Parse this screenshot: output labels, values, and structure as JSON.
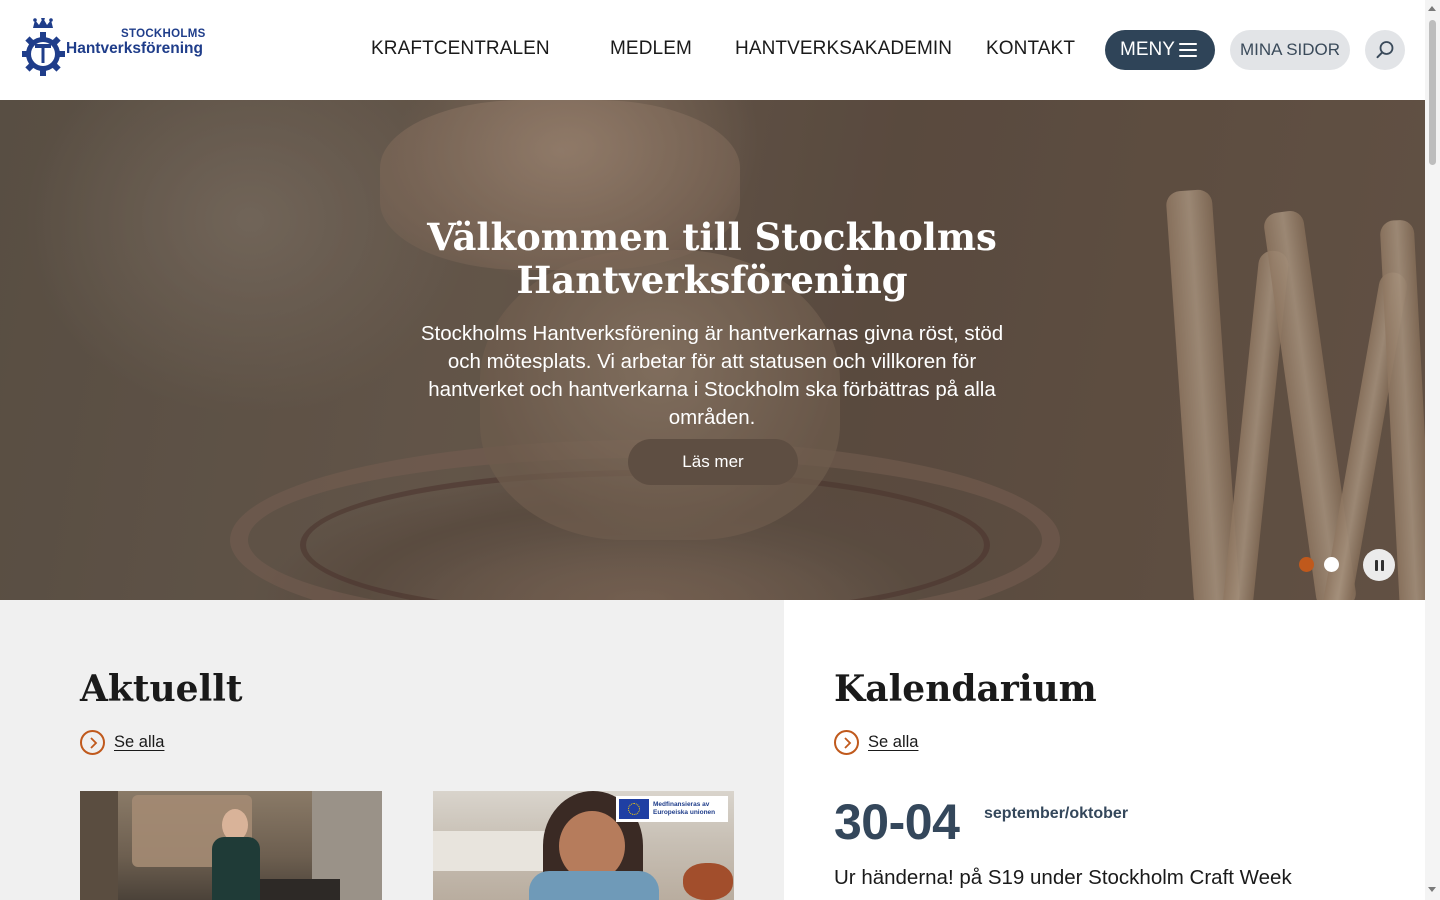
{
  "brand": {
    "logo_small": "STOCKHOLMS",
    "logo_big": "Hantverksförening",
    "accent_color": "#c0591c",
    "primary_dark": "#2f4458"
  },
  "nav": {
    "items": [
      {
        "label": "KRAFTCENTRALEN"
      },
      {
        "label": "MEDLEM"
      },
      {
        "label": "HANTVERKSAKADEMIN"
      },
      {
        "label": "KONTAKT"
      }
    ],
    "menu_label": "MENY",
    "mina_sidor_label": "MINA SIDOR",
    "search_icon": "search-icon"
  },
  "hero": {
    "title": "Välkommen till Stockholms Hantverksförening",
    "text": "Stockholms Hantverksförening är hantverkarnas givna röst, stöd och mötesplats. Vi arbetar för att statusen och villkoren för hantverket och hantverkarna i Stockholm ska förbättras på alla områden.",
    "cta_label": "Läs mer",
    "slides_total": 2,
    "active_slide": 1
  },
  "aktuellt": {
    "title": "Aktuellt",
    "see_all_label": "Se alla",
    "card2_badge": "Medfinansieras av Europeiska unionen"
  },
  "kalendarium": {
    "title": "Kalendarium",
    "see_all_label": "Se alla",
    "event": {
      "date": "30-04",
      "month": "september/oktober",
      "title": "Ur händerna! på S19 under Stockholm Craft Week"
    }
  }
}
